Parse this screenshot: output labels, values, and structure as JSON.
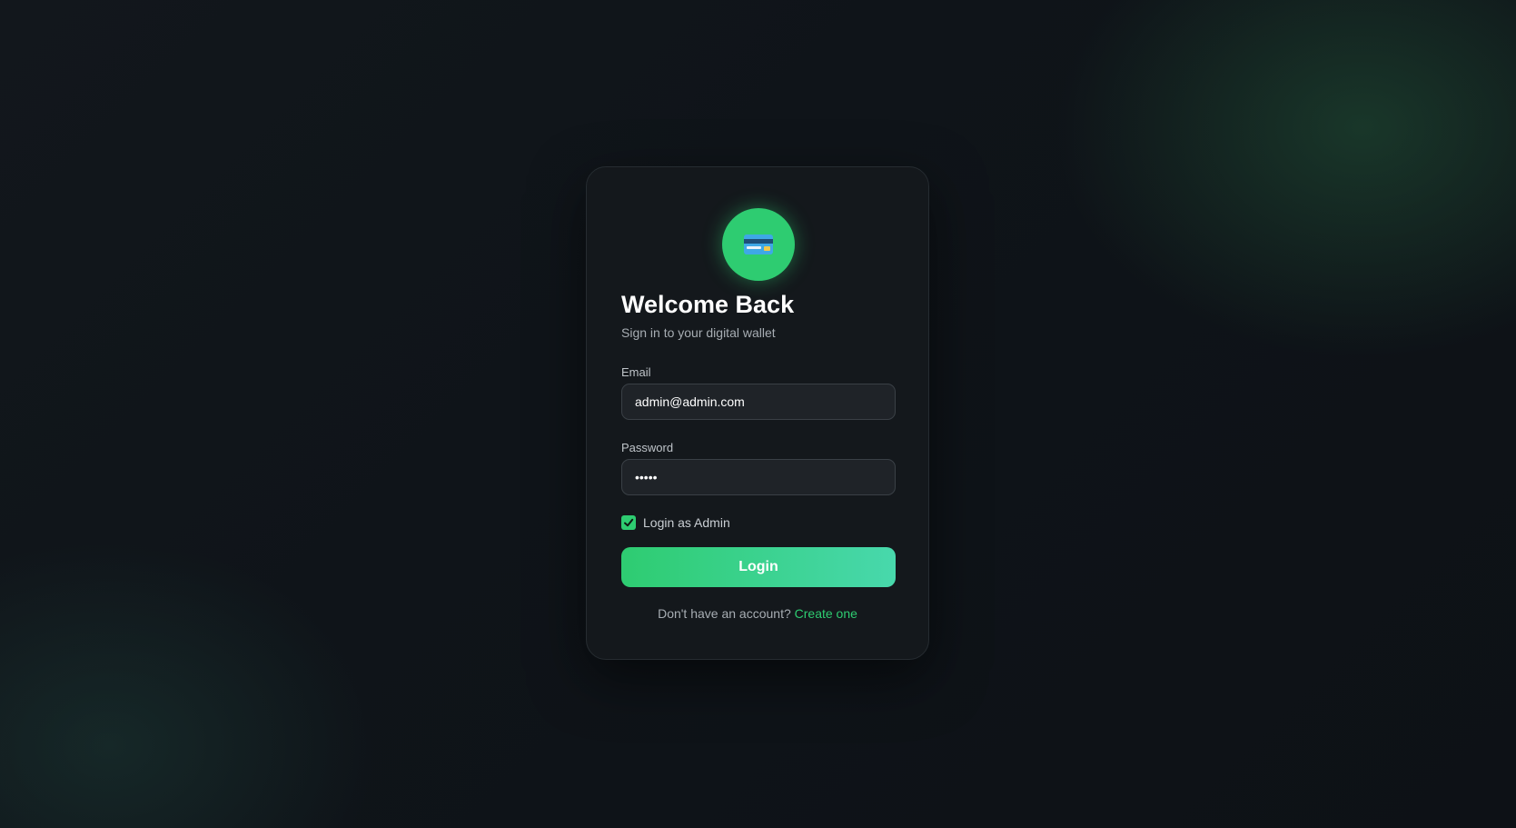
{
  "brand": {
    "icon": "credit-card-icon",
    "accent_color": "#2ecc71"
  },
  "header": {
    "title": "Welcome Back",
    "subtitle": "Sign in to your digital wallet"
  },
  "form": {
    "email": {
      "label": "Email",
      "value": "admin@admin.com"
    },
    "password": {
      "label": "Password",
      "value": "•••••"
    },
    "admin_checkbox": {
      "label": "Login as Admin",
      "checked": true
    },
    "submit_label": "Login"
  },
  "footer": {
    "prompt": "Don't have an account?",
    "link_label": "Create one"
  }
}
